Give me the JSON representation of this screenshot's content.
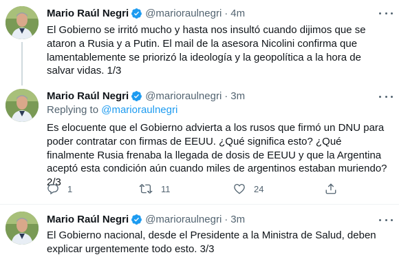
{
  "tweets": [
    {
      "author": {
        "name": "Mario Raúl Negri",
        "handle": "@marioraulnegri"
      },
      "time": "4m",
      "text": "El Gobierno se irritó mucho y hasta nos insultó cuando dijimos que se ataron a Rusia y a Putin. El mail de la asesora Nicolini confirma que lamentablemente se priorizó la ideología y la geopolítica a la hora de salvar vidas. 1/3"
    },
    {
      "author": {
        "name": "Mario Raúl Negri",
        "handle": "@marioraulnegri"
      },
      "time": "3m",
      "replying_label": "Replying to",
      "replying_to": "@marioraulnegri",
      "text": "Es elocuente que el Gobierno advierta a los rusos que firmó un DNU para poder contratar con firmas de EEUU. ¿Qué significa esto? ¿Qué finalmente Rusia frenaba la llegada de dosis de EEUU y que la Argentina aceptó esta condición aún cuando miles de argentinos estaban muriendo? 2/3",
      "actions": {
        "replies": "1",
        "retweets": "11",
        "likes": "24"
      }
    },
    {
      "author": {
        "name": "Mario Raúl Negri",
        "handle": "@marioraulnegri"
      },
      "time": "3m",
      "text": "El Gobierno nacional, desde el Presidente a la Ministra de Salud, deben explicar urgentemente todo esto. 3/3"
    }
  ],
  "separator": "·",
  "colors": {
    "accent": "#1d9bf0",
    "text": "#0f1419",
    "muted": "#536471",
    "line": "#cfd9de"
  },
  "icons": [
    "verified-badge-icon",
    "more-icon",
    "reply-icon",
    "retweet-icon",
    "like-icon",
    "share-icon"
  ]
}
